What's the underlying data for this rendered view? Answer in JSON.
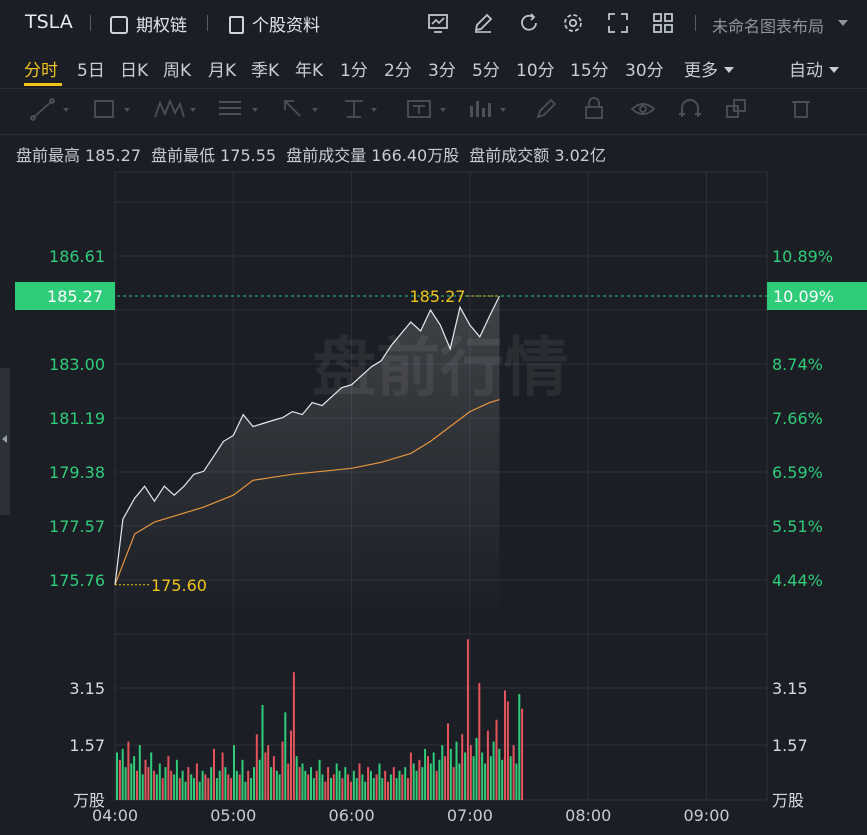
{
  "header": {
    "ticker": "TSLA",
    "options_chain": "期权链",
    "stock_info": "个股资料",
    "layout_name": "未命名图表布局",
    "icons": [
      "chart-icon",
      "pen-icon",
      "refresh-icon",
      "gear-icon",
      "expand-icon",
      "grid-icon"
    ]
  },
  "periods": [
    "分时",
    "5日",
    "日K",
    "周K",
    "月K",
    "季K",
    "年K",
    "1分",
    "2分",
    "3分",
    "5分",
    "10分",
    "15分",
    "30分",
    "更多"
  ],
  "active_period": "分时",
  "auto_label": "自动",
  "draw_tools": [
    "line-tool-icon",
    "rect-tool-icon",
    "wave-tool-icon",
    "fib-tool-icon",
    "arrow-tool-icon",
    "measure-tool-icon",
    "text-tool-icon",
    "bars-tool-icon",
    "brush-icon",
    "lock-icon",
    "eye-icon",
    "magnet-icon",
    "layers-icon",
    "trash-icon"
  ],
  "info": {
    "high_label": "盘前最高",
    "high_value": "185.27",
    "low_label": "盘前最低",
    "low_value": "175.55",
    "vol_label": "盘前成交量",
    "vol_value": "166.40万股",
    "amt_label": "盘前成交额",
    "amt_value": "3.02亿"
  },
  "chart_data": {
    "type": "line",
    "watermark": "盘前行情",
    "x_ticks": [
      "04:00",
      "05:00",
      "06:00",
      "07:00",
      "08:00",
      "09:00"
    ],
    "price_axis": {
      "ticks": [
        "186.61",
        "183.00",
        "181.19",
        "179.38",
        "177.57",
        "175.76"
      ],
      "ylim": [
        175.76,
        186.61
      ]
    },
    "pct_axis": {
      "ticks": [
        "10.89%",
        "8.74%",
        "7.66%",
        "6.59%",
        "5.51%",
        "4.44%"
      ]
    },
    "current_price": "185.27",
    "current_pct": "10.09%",
    "max_label": "185.27",
    "min_label": "175.60",
    "series": [
      {
        "color": "#e6e9ee",
        "points": [
          [
            "04:00",
            175.6
          ],
          [
            "04:04",
            177.8
          ],
          [
            "04:10",
            178.5
          ],
          [
            "04:15",
            178.9
          ],
          [
            "04:20",
            178.4
          ],
          [
            "04:25",
            178.9
          ],
          [
            "04:30",
            178.6
          ],
          [
            "04:35",
            178.9
          ],
          [
            "04:40",
            179.3
          ],
          [
            "04:45",
            179.4
          ],
          [
            "04:50",
            179.9
          ],
          [
            "04:55",
            180.4
          ],
          [
            "05:00",
            180.6
          ],
          [
            "05:05",
            181.3
          ],
          [
            "05:10",
            180.9
          ],
          [
            "05:15",
            181.0
          ],
          [
            "05:20",
            181.1
          ],
          [
            "05:25",
            181.2
          ],
          [
            "05:30",
            181.4
          ],
          [
            "05:35",
            181.3
          ],
          [
            "05:40",
            181.7
          ],
          [
            "05:45",
            181.6
          ],
          [
            "05:50",
            181.9
          ],
          [
            "05:55",
            182.2
          ],
          [
            "06:00",
            182.3
          ],
          [
            "06:05",
            182.6
          ],
          [
            "06:10",
            182.9
          ],
          [
            "06:15",
            183.1
          ],
          [
            "06:20",
            183.6
          ],
          [
            "06:25",
            184.0
          ],
          [
            "06:30",
            184.4
          ],
          [
            "06:35",
            184.1
          ],
          [
            "06:40",
            184.8
          ],
          [
            "06:45",
            184.3
          ],
          [
            "06:50",
            183.5
          ],
          [
            "06:55",
            184.9
          ],
          [
            "07:00",
            184.3
          ],
          [
            "07:05",
            183.9
          ],
          [
            "07:10",
            184.6
          ],
          [
            "07:15",
            185.27
          ]
        ]
      },
      {
        "color": "#e8963e",
        "points": [
          [
            "04:00",
            175.6
          ],
          [
            "04:10",
            177.3
          ],
          [
            "04:20",
            177.7
          ],
          [
            "04:30",
            177.9
          ],
          [
            "04:45",
            178.2
          ],
          [
            "05:00",
            178.6
          ],
          [
            "05:10",
            179.1
          ],
          [
            "05:20",
            179.2
          ],
          [
            "05:30",
            179.3
          ],
          [
            "05:45",
            179.4
          ],
          [
            "06:00",
            179.5
          ],
          [
            "06:15",
            179.7
          ],
          [
            "06:30",
            180.0
          ],
          [
            "06:40",
            180.4
          ],
          [
            "06:50",
            180.9
          ],
          [
            "07:00",
            181.4
          ],
          [
            "07:10",
            181.7
          ],
          [
            "07:15",
            181.8
          ]
        ]
      }
    ],
    "volume": {
      "ticks": [
        "3.15",
        "1.57"
      ],
      "unit": "万股",
      "ylim": [
        0,
        4.6
      ],
      "bars": [
        1.3,
        1.1,
        1.4,
        0.9,
        1.6,
        1.0,
        1.2,
        0.8,
        1.5,
        0.7,
        1.1,
        0.9,
        1.3,
        0.8,
        0.7,
        1.0,
        0.6,
        0.9,
        1.2,
        0.8,
        0.7,
        1.1,
        0.6,
        0.8,
        0.5,
        0.9,
        0.7,
        0.6,
        1.0,
        0.5,
        0.8,
        0.7,
        0.6,
        0.9,
        1.4,
        0.6,
        0.8,
        1.3,
        0.9,
        0.7,
        0.6,
        1.5,
        0.8,
        0.7,
        1.1,
        0.5,
        0.8,
        0.6,
        0.9,
        1.8,
        1.1,
        2.6,
        1.3,
        1.5,
        0.9,
        1.2,
        0.8,
        0.7,
        1.6,
        2.4,
        1.0,
        1.9,
        3.5,
        1.2,
        0.9,
        1.0,
        0.8,
        0.7,
        0.9,
        0.6,
        0.8,
        1.1,
        0.7,
        0.5,
        0.9,
        0.6,
        0.7,
        1.0,
        0.8,
        0.6,
        0.9,
        0.7,
        0.5,
        0.8,
        0.6,
        1.0,
        0.7,
        0.5,
        0.9,
        0.8,
        0.6,
        0.7,
        1.0,
        0.6,
        0.8,
        0.5,
        0.7,
        0.9,
        0.6,
        0.8,
        0.7,
        0.9,
        0.6,
        1.3,
        1.0,
        0.8,
        1.1,
        0.9,
        1.4,
        1.2,
        1.0,
        1.3,
        0.8,
        1.1,
        1.5,
        1.2,
        2.1,
        1.4,
        0.9,
        1.6,
        1.0,
        1.8,
        1.3,
        4.4,
        1.5,
        1.2,
        1.7,
        3.2,
        1.3,
        1.0,
        1.9,
        1.2,
        1.6,
        2.2,
        1.4,
        1.1,
        3.0,
        2.7,
        1.2,
        1.5,
        1.0,
        2.9,
        2.5
      ]
    }
  }
}
